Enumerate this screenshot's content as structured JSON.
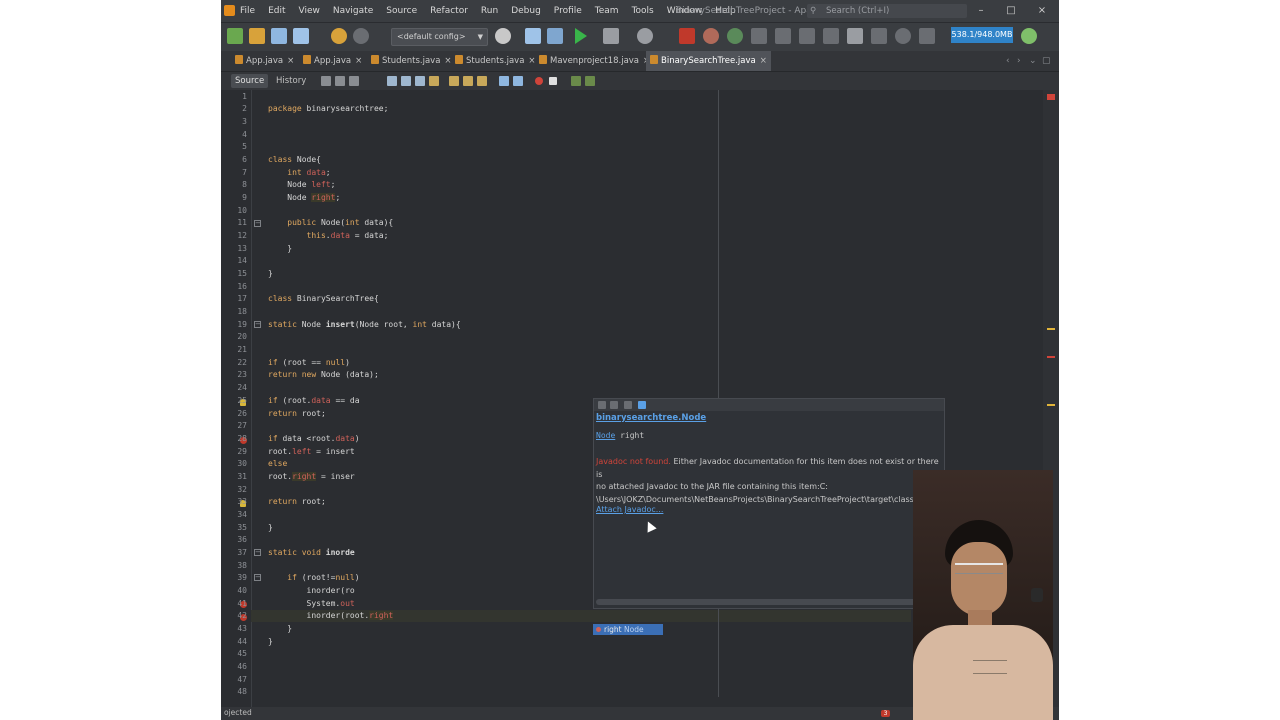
{
  "menubar": {
    "items": [
      "File",
      "Edit",
      "View",
      "Navigate",
      "Source",
      "Refactor",
      "Run",
      "Debug",
      "Profile",
      "Team",
      "Tools",
      "Window",
      "Help"
    ],
    "window_title": "BinarySearchTreeProject - Apa...",
    "search_placeholder": "Search (Ctrl+I)",
    "window_buttons": [
      "–",
      "□",
      "×"
    ]
  },
  "toolbar": {
    "config": "<default config>",
    "memory": "538.1/948.0MB",
    "icons": [
      "new-project-icon",
      "open-project-icon",
      "save-all-icon",
      "undo-icon",
      "redo-icon",
      "build-icon",
      "clean-build-icon",
      "run-icon",
      "debug-icon",
      "profile-icon",
      "stop-icon"
    ]
  },
  "tabs": [
    {
      "label": "App.java",
      "active": false
    },
    {
      "label": "App.java",
      "active": false
    },
    {
      "label": "Students.java",
      "active": false
    },
    {
      "label": "Students.java",
      "active": false
    },
    {
      "label": "Mavenproject18.java",
      "active": false
    },
    {
      "label": "BinarySearchTree.java",
      "active": true
    }
  ],
  "editor_toolbar": {
    "source_label": "Source",
    "history_label": "History"
  },
  "code": {
    "lines": [
      {
        "n": "1",
        "segs": [
          {
            "t": ""
          }
        ]
      },
      {
        "n": "2",
        "segs": [
          {
            "t": "package ",
            "c": "kw"
          },
          {
            "t": "binarysearchtree;"
          }
        ]
      },
      {
        "n": "3",
        "segs": [
          {
            "t": ""
          }
        ]
      },
      {
        "n": "4",
        "segs": [
          {
            "t": ""
          }
        ]
      },
      {
        "n": "5",
        "segs": [
          {
            "t": ""
          }
        ]
      },
      {
        "n": "6",
        "segs": [
          {
            "t": "class ",
            "c": "kw"
          },
          {
            "t": "Node{"
          }
        ]
      },
      {
        "n": "7",
        "segs": [
          {
            "t": "    "
          },
          {
            "t": "int ",
            "c": "kw"
          },
          {
            "t": "data",
            "c": "fld"
          },
          {
            "t": ";"
          }
        ]
      },
      {
        "n": "8",
        "segs": [
          {
            "t": "    Node "
          },
          {
            "t": "left",
            "c": "fld"
          },
          {
            "t": ";"
          }
        ]
      },
      {
        "n": "9",
        "segs": [
          {
            "t": "    Node "
          },
          {
            "t": "right",
            "c": "fld hl"
          },
          {
            "t": ";"
          }
        ]
      },
      {
        "n": "10",
        "segs": [
          {
            "t": ""
          }
        ]
      },
      {
        "n": "11",
        "segs": [
          {
            "t": "    "
          },
          {
            "t": "public ",
            "c": "kw"
          },
          {
            "t": "Node("
          },
          {
            "t": "int ",
            "c": "kw"
          },
          {
            "t": "data){"
          }
        ]
      },
      {
        "n": "12",
        "segs": [
          {
            "t": "        "
          },
          {
            "t": "this",
            "c": "kw"
          },
          {
            "t": "."
          },
          {
            "t": "data",
            "c": "fld"
          },
          {
            "t": " = data;"
          }
        ]
      },
      {
        "n": "13",
        "segs": [
          {
            "t": "    }"
          }
        ]
      },
      {
        "n": "14",
        "segs": [
          {
            "t": ""
          }
        ]
      },
      {
        "n": "15",
        "segs": [
          {
            "t": "}"
          }
        ]
      },
      {
        "n": "16",
        "segs": [
          {
            "t": ""
          }
        ]
      },
      {
        "n": "17",
        "segs": [
          {
            "t": "class ",
            "c": "kw"
          },
          {
            "t": "BinarySearchTree{"
          }
        ]
      },
      {
        "n": "18",
        "segs": [
          {
            "t": ""
          }
        ]
      },
      {
        "n": "19",
        "segs": [
          {
            "t": "static ",
            "c": "kw"
          },
          {
            "t": "Node "
          },
          {
            "t": "insert",
            "c": "b"
          },
          {
            "t": "(Node root, "
          },
          {
            "t": "int ",
            "c": "kw"
          },
          {
            "t": "data){"
          }
        ]
      },
      {
        "n": "20",
        "segs": [
          {
            "t": ""
          }
        ]
      },
      {
        "n": "21",
        "segs": [
          {
            "t": ""
          }
        ]
      },
      {
        "n": "22",
        "segs": [
          {
            "t": "if ",
            "c": "kw"
          },
          {
            "t": "(root == "
          },
          {
            "t": "null",
            "c": "kw"
          },
          {
            "t": ")"
          }
        ]
      },
      {
        "n": "23",
        "segs": [
          {
            "t": "return new ",
            "c": "kw"
          },
          {
            "t": "Node (data);"
          }
        ]
      },
      {
        "n": "24",
        "segs": [
          {
            "t": ""
          }
        ]
      },
      {
        "n": "25",
        "segs": [
          {
            "t": "if ",
            "c": "kw"
          },
          {
            "t": "(root."
          },
          {
            "t": "data",
            "c": "fld"
          },
          {
            "t": " == da"
          }
        ]
      },
      {
        "n": "26",
        "segs": [
          {
            "t": "return ",
            "c": "kw"
          },
          {
            "t": "root;"
          }
        ]
      },
      {
        "n": "27",
        "segs": [
          {
            "t": ""
          }
        ]
      },
      {
        "n": "28",
        "segs": [
          {
            "t": "if ",
            "c": "kw"
          },
          {
            "t": "data <root."
          },
          {
            "t": "data",
            "c": "fld"
          },
          {
            "t": ")"
          }
        ]
      },
      {
        "n": "29",
        "segs": [
          {
            "t": "root."
          },
          {
            "t": "left",
            "c": "fld"
          },
          {
            "t": " = insert"
          }
        ]
      },
      {
        "n": "30",
        "segs": [
          {
            "t": "else",
            "c": "kw"
          }
        ]
      },
      {
        "n": "31",
        "segs": [
          {
            "t": "root."
          },
          {
            "t": "right",
            "c": "fld hl"
          },
          {
            "t": " = inser"
          }
        ]
      },
      {
        "n": "32",
        "segs": [
          {
            "t": ""
          }
        ]
      },
      {
        "n": "33",
        "segs": [
          {
            "t": "return ",
            "c": "kw"
          },
          {
            "t": "root;"
          }
        ]
      },
      {
        "n": "34",
        "segs": [
          {
            "t": ""
          }
        ]
      },
      {
        "n": "35",
        "segs": [
          {
            "t": "}"
          }
        ]
      },
      {
        "n": "36",
        "segs": [
          {
            "t": ""
          }
        ]
      },
      {
        "n": "37",
        "segs": [
          {
            "t": "static void ",
            "c": "kw"
          },
          {
            "t": "inorde",
            "c": "b"
          }
        ]
      },
      {
        "n": "38",
        "segs": [
          {
            "t": ""
          }
        ]
      },
      {
        "n": "39",
        "segs": [
          {
            "t": "    "
          },
          {
            "t": "if ",
            "c": "kw"
          },
          {
            "t": "(root!="
          },
          {
            "t": "null",
            "c": "kw"
          },
          {
            "t": ")"
          }
        ]
      },
      {
        "n": "40",
        "segs": [
          {
            "t": "        inorder(ro"
          }
        ]
      },
      {
        "n": "41",
        "segs": [
          {
            "t": "        System."
          },
          {
            "t": "out",
            "c": "fld"
          }
        ]
      },
      {
        "n": "42",
        "segs": [
          {
            "t": "        inorder(root."
          },
          {
            "t": "right",
            "c": "fld hl"
          }
        ]
      },
      {
        "n": "43",
        "segs": [
          {
            "t": "    }"
          }
        ]
      },
      {
        "n": "44",
        "segs": [
          {
            "t": "}"
          }
        ]
      },
      {
        "n": "45",
        "segs": [
          {
            "t": ""
          }
        ]
      },
      {
        "n": "46",
        "segs": [
          {
            "t": ""
          }
        ]
      },
      {
        "n": "47",
        "segs": [
          {
            "t": ""
          }
        ]
      },
      {
        "n": "48",
        "segs": [
          {
            "t": ""
          }
        ]
      }
    ]
  },
  "javadoc_popup": {
    "class_link": "binarysearchtree.Node",
    "sig_type": "Node",
    "sig_name": " right",
    "warn": "Javadoc not found.",
    "desc1": " Either Javadoc documentation for this item does not exist or there is",
    "desc2": "no attached Javadoc to the JAR file containing this item:C:",
    "desc3": "\\Users\\JOKZ\\Documents\\NetBeansProjects\\BinarySearchTreeProject\\target\\classes",
    "attach_label": "Attach Javadoc..."
  },
  "completion": {
    "name": "right",
    "type": "Node"
  },
  "status": {
    "text": "ojected",
    "notifications": "3"
  },
  "colors": {
    "ide_bg": "#2b2d31",
    "keyword": "#e0a860",
    "field": "#d0625a",
    "link": "#5aa0e6",
    "error_marker": "#c0392b"
  }
}
